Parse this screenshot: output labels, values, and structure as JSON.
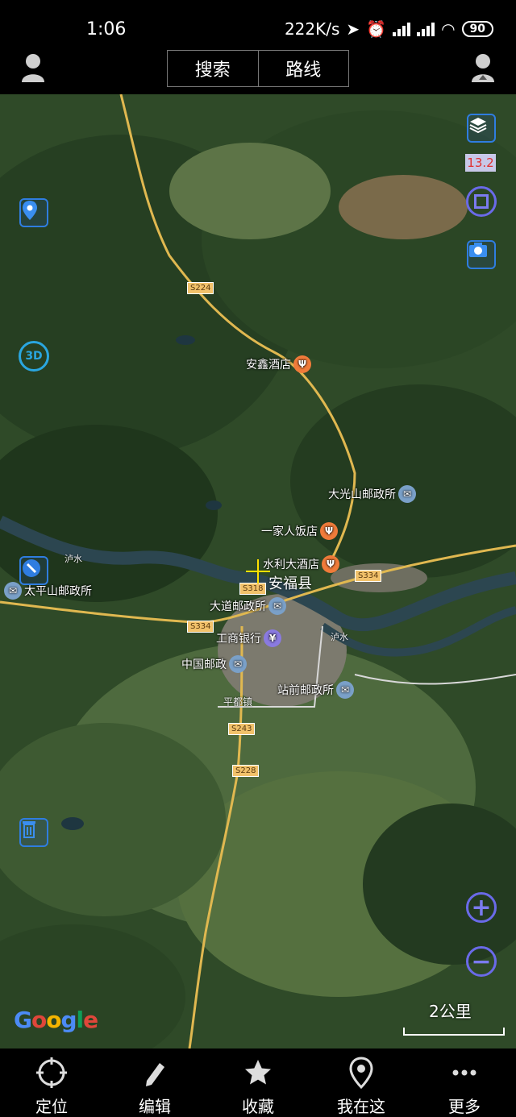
{
  "status_bar": {
    "time": "1:06",
    "net_speed": "222K/s",
    "battery": "90"
  },
  "header": {
    "tab_search": "搜索",
    "tab_route": "路线"
  },
  "map": {
    "zoom_level": "13.2",
    "pois": {
      "anxin_hotel": "安鑫酒店",
      "daguangshan_post": "大光山邮政所",
      "yijiaren_restaurant": "一家人饭店",
      "shuili_hotel": "水利大酒店",
      "anfu_county": "安福县",
      "taipingshan_post": "太平山邮政所",
      "dadao_post": "大道邮政所",
      "icbc": "工商银行",
      "china_post": "中国邮政",
      "zhanqian_post": "站前邮政所",
      "pingdu_town": "平都镇"
    },
    "roads": {
      "s224": "S224",
      "s318": "S318",
      "s334_east": "S334",
      "s334_west": "S334",
      "s243": "S243",
      "s228": "S228"
    },
    "river_labels": {
      "lu_west": "泸水",
      "lu_east": "泸水"
    },
    "google": "Google",
    "scale": "2公里"
  },
  "bottom_nav": [
    {
      "label": "定位"
    },
    {
      "label": "编辑"
    },
    {
      "label": "收藏"
    },
    {
      "label": "我在这"
    },
    {
      "label": "更多"
    }
  ],
  "colors": {
    "accent_blue": "#2f7de0",
    "round_button": "#6a6ae8",
    "road_yellow": "#f2c26b",
    "food_poi": "#f07b3a",
    "post_poi": "#7aa0c8"
  }
}
